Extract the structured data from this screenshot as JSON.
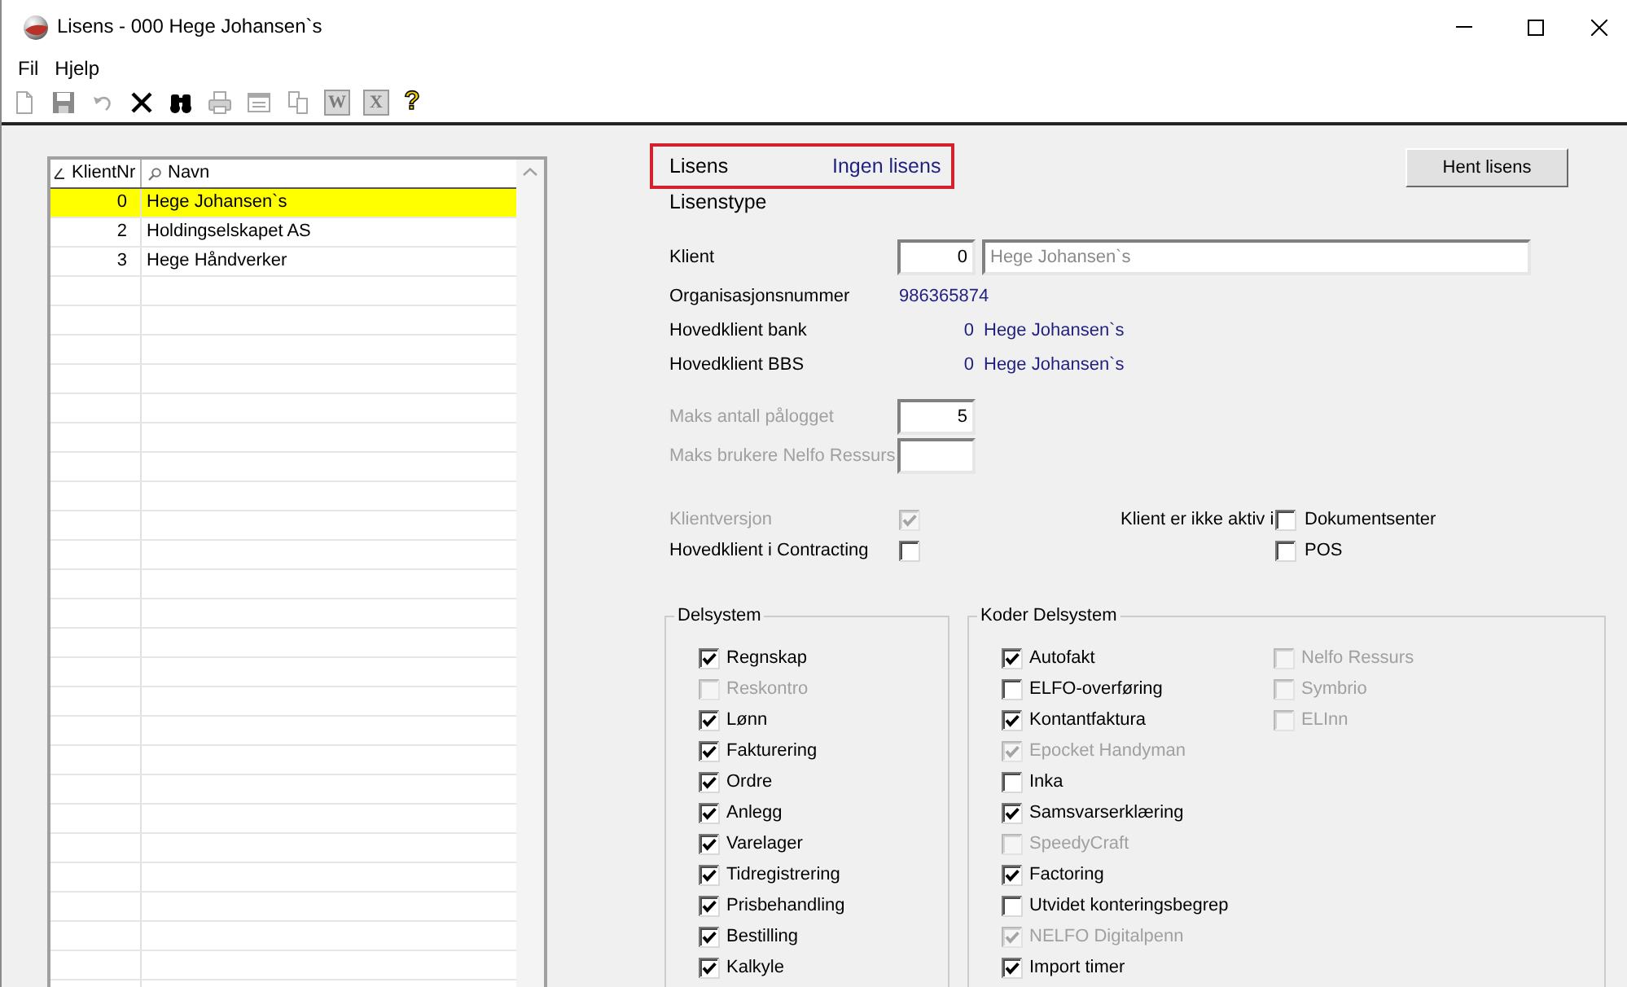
{
  "window": {
    "title": "Lisens - 000 Hege Johansen`s"
  },
  "menu": [
    {
      "label": "Fil"
    },
    {
      "label": "Hjelp"
    }
  ],
  "toolbar": [
    {
      "kind": "new",
      "disabled": true
    },
    {
      "kind": "save",
      "disabled": true
    },
    {
      "kind": "undo",
      "disabled": true
    },
    {
      "kind": "delete",
      "disabled": false
    },
    {
      "kind": "find",
      "disabled": false
    },
    {
      "kind": "print",
      "disabled": true
    },
    {
      "kind": "form",
      "disabled": true
    },
    {
      "kind": "copy",
      "disabled": true
    },
    {
      "kind": "tile",
      "glyph": "W",
      "disabled": true
    },
    {
      "kind": "tile",
      "glyph": "X",
      "disabled": true
    },
    {
      "kind": "help",
      "glyph": "?",
      "disabled": false
    }
  ],
  "client_list": {
    "columns": [
      {
        "label": "KlientNr"
      },
      {
        "label": "Navn"
      }
    ],
    "rows": [
      {
        "number": "0",
        "name": "Hege Johansen`s",
        "selected": true
      },
      {
        "number": "2",
        "name": "Holdingselskapet AS",
        "selected": false
      },
      {
        "number": "3",
        "name": "Hege Håndverker",
        "selected": false
      }
    ]
  },
  "license": {
    "label": "Lisens",
    "value": "Ingen lisens",
    "highlighted": true
  },
  "fetch_button": {
    "label": "Hent lisens"
  },
  "license_type": {
    "label": "Lisenstype"
  },
  "client": {
    "label": "Klient",
    "number_field": {
      "value": "0"
    },
    "name_field": {
      "value": "Hege Johansen`s",
      "disabled": true
    }
  },
  "org_number": {
    "label": "Organisasjonsnummer",
    "value": "986365874"
  },
  "main_clients": [
    {
      "label": "Hovedklient bank",
      "number": "0",
      "name": "Hege Johansen`s"
    },
    {
      "label": "Hovedklient BBS",
      "number": "0",
      "name": "Hege Johansen`s"
    }
  ],
  "limits": [
    {
      "label": "Maks antall pålogget",
      "value": "5",
      "disabled": true
    },
    {
      "label": "Maks brukere Nelfo Ressurs",
      "disabled": true
    }
  ],
  "options": [
    {
      "label": "Klientversjon",
      "checked": true,
      "disabled": true
    },
    {
      "label": "Hovedklient i Contracting",
      "checked": false,
      "disabled": false
    }
  ],
  "inactive_in": {
    "label": "Klient er ikke aktiv i",
    "items": [
      {
        "label": "Dokumentsenter",
        "checked": false
      },
      {
        "label": "POS",
        "checked": false
      }
    ]
  },
  "delsystem": {
    "title": "Delsystem",
    "items": [
      {
        "label": "Regnskap",
        "checked": true,
        "disabled": false
      },
      {
        "label": "Reskontro",
        "checked": false,
        "disabled": true
      },
      {
        "label": "Lønn",
        "checked": true,
        "disabled": false
      },
      {
        "label": "Fakturering",
        "checked": true,
        "disabled": false
      },
      {
        "label": "Ordre",
        "checked": true,
        "disabled": false
      },
      {
        "label": "Anlegg",
        "checked": true,
        "disabled": false
      },
      {
        "label": "Varelager",
        "checked": true,
        "disabled": false
      },
      {
        "label": "Tidregistrering",
        "checked": true,
        "disabled": false
      },
      {
        "label": "Prisbehandling",
        "checked": true,
        "disabled": false
      },
      {
        "label": "Bestilling",
        "checked": true,
        "disabled": false
      },
      {
        "label": "Kalkyle",
        "checked": true,
        "disabled": false
      }
    ]
  },
  "koder_delsystem": {
    "title": "Koder Delsystem",
    "columns": [
      [
        {
          "label": "Autofakt",
          "checked": true,
          "disabled": false
        },
        {
          "label": "ELFO-overføring",
          "checked": false,
          "disabled": false
        },
        {
          "label": "Kontantfaktura",
          "checked": true,
          "disabled": false
        },
        {
          "label": "Epocket Handyman",
          "checked": true,
          "disabled": true
        },
        {
          "label": "Inka",
          "checked": false,
          "disabled": false
        },
        {
          "label": "Samsvarserklæring",
          "checked": true,
          "disabled": false
        },
        {
          "label": "SpeedyCraft",
          "checked": false,
          "disabled": true
        },
        {
          "label": "Factoring",
          "checked": true,
          "disabled": false
        },
        {
          "label": "Utvidet konteringsbegrep",
          "checked": false,
          "disabled": false
        },
        {
          "label": "NELFO Digitalpenn",
          "checked": true,
          "disabled": true
        },
        {
          "label": "Import timer",
          "checked": true,
          "disabled": false
        }
      ],
      [
        {
          "label": "Nelfo Ressurs",
          "checked": false,
          "disabled": true
        },
        {
          "label": "Symbrio",
          "checked": false,
          "disabled": true
        },
        {
          "label": "ELInn",
          "checked": false,
          "disabled": true
        }
      ]
    ]
  }
}
